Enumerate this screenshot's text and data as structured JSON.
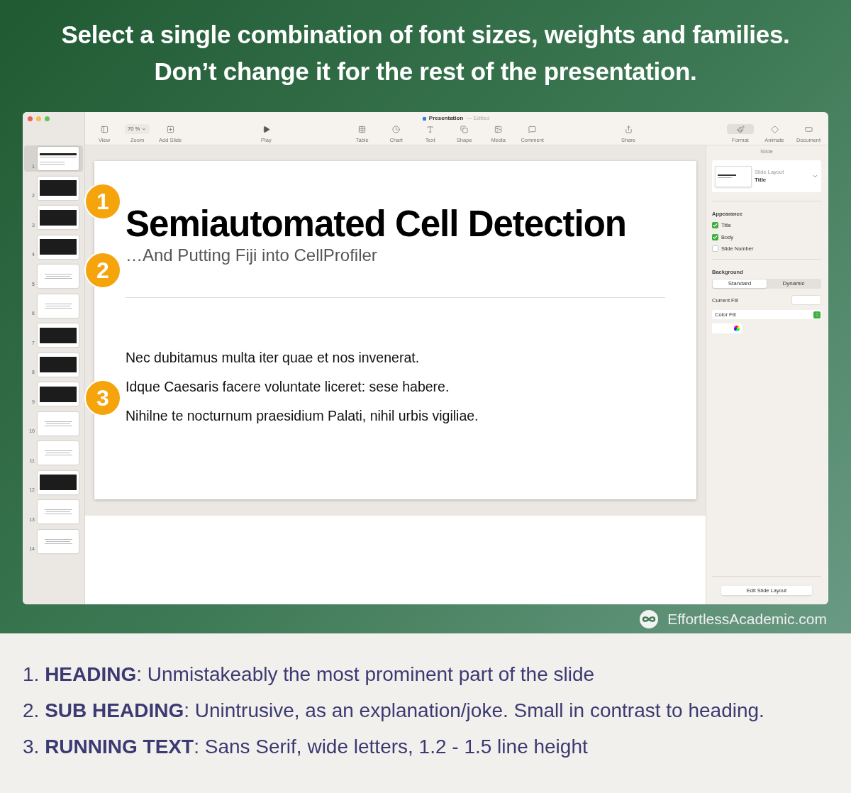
{
  "headline": [
    "Select a single combination of font sizes, weights and families.",
    "Don’t change it for the rest of the presentation."
  ],
  "window": {
    "title": "Presentation",
    "status": "— Edited"
  },
  "toolbar": [
    {
      "label": "View",
      "kind": "view"
    },
    {
      "label": "Zoom",
      "kind": "zoom",
      "value": "70 %"
    },
    {
      "label": "Add Slide",
      "kind": "add"
    },
    {
      "label": "Play",
      "kind": "play"
    },
    {
      "label": "Table",
      "kind": "table"
    },
    {
      "label": "Chart",
      "kind": "chart"
    },
    {
      "label": "Text",
      "kind": "text"
    },
    {
      "label": "Shape",
      "kind": "shape"
    },
    {
      "label": "Media",
      "kind": "media"
    },
    {
      "label": "Comment",
      "kind": "comment"
    },
    {
      "label": "Share",
      "kind": "share"
    }
  ],
  "inspector_tabs": [
    {
      "label": "Format",
      "kind": "format",
      "selected": true
    },
    {
      "label": "Animate",
      "kind": "animate",
      "selected": false
    },
    {
      "label": "Document",
      "kind": "document",
      "selected": false
    }
  ],
  "thumbnails": [
    {
      "number": "1",
      "kind": "title",
      "selected": true
    },
    {
      "number": "2",
      "kind": "image",
      "selected": false
    },
    {
      "number": "3",
      "kind": "image",
      "selected": false
    },
    {
      "number": "4",
      "kind": "image",
      "selected": false
    },
    {
      "number": "5",
      "kind": "text",
      "selected": false
    },
    {
      "number": "6",
      "kind": "text",
      "selected": false
    },
    {
      "number": "7",
      "kind": "image",
      "selected": false
    },
    {
      "number": "8",
      "kind": "image",
      "selected": false
    },
    {
      "number": "9",
      "kind": "image",
      "selected": false
    },
    {
      "number": "10",
      "kind": "text",
      "selected": false
    },
    {
      "number": "11",
      "kind": "text",
      "selected": false
    },
    {
      "number": "12",
      "kind": "image",
      "selected": false
    },
    {
      "number": "13",
      "kind": "text",
      "selected": false
    },
    {
      "number": "14",
      "kind": "text",
      "selected": false
    }
  ],
  "slide": {
    "title": "Semiautomated Cell Detection",
    "subtitle": "…And Putting Fiji into CellProfiler",
    "body": [
      "Nec dubitamus multa iter quae et nos invenerat.",
      "Idque Caesaris facere voluntate liceret: sese habere.",
      "Nihilne te nocturnum praesidium Palati, nihil urbis vigiliae."
    ]
  },
  "callouts": [
    "1",
    "2",
    "3"
  ],
  "inspector": {
    "heading": "Slide",
    "layout_label": "Slide Layout",
    "layout_value": "Title",
    "appearance": "Appearance",
    "checks": [
      {
        "label": "Title",
        "checked": true
      },
      {
        "label": "Body",
        "checked": true
      },
      {
        "label": "Slide Number",
        "checked": false
      }
    ],
    "background": "Background",
    "segments": [
      {
        "label": "Standard",
        "selected": true
      },
      {
        "label": "Dynamic",
        "selected": false
      }
    ],
    "current_fill": "Current Fill",
    "fill_type": "Color Fill",
    "edit_button": "Edit Slide Layout"
  },
  "brand": "EffortlessAcademic.com",
  "notes": [
    "1. **HEADING**: Unmistakeably the most prominent part of the slide",
    "2. **SUB HEADING**: Unintrusive, as an explanation/joke. Small in contrast to heading.",
    "3. **RUNNING TEXT**: Sans Serif, wide letters, 1.2 - 1.5 line height"
  ]
}
